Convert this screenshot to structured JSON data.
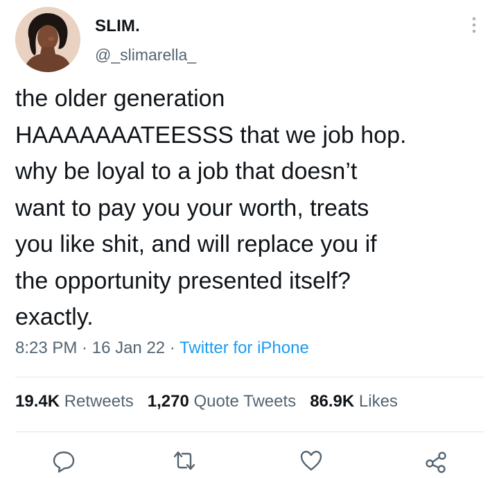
{
  "user": {
    "display_name": "SLIM.",
    "handle": "@_slimarella_",
    "avatar_icon": "profile-avatar"
  },
  "tweet": {
    "text": "the older generation\nHAAAAAAATEESSS that we job hop.\nwhy be loyal to a job that doesn’t\nwant to pay you your worth, treats\nyou like shit, and will replace you if\nthe opportunity presented itself?\nexactly.",
    "time": "8:23 PM",
    "sep1": " · ",
    "date": "16 Jan 22",
    "sep2": " · ",
    "source": "Twitter for iPhone"
  },
  "stats": {
    "retweets_count": "19.4K",
    "retweets_label": "Retweets",
    "quotes_count": "1,270",
    "quotes_label": "Quote Tweets",
    "likes_count": "86.9K",
    "likes_label": "Likes"
  },
  "icons": {
    "more": "more-vertical-icon",
    "reply": "reply-icon",
    "retweet": "retweet-icon",
    "like": "heart-icon",
    "share": "share-icon"
  },
  "colors": {
    "text": "#0f1419",
    "secondary": "#536471",
    "link": "#1d9bf0",
    "divider": "#dfe4e7"
  }
}
